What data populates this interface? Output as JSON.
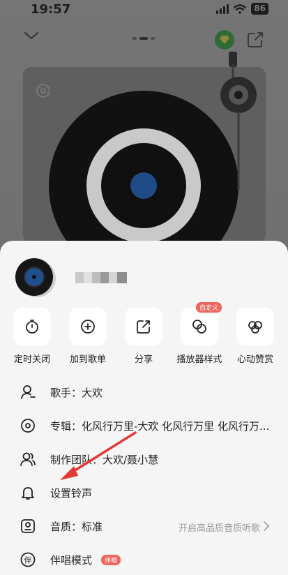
{
  "status_bar": {
    "time": "19:57",
    "battery": "86"
  },
  "sheet": {
    "actions": [
      {
        "label": "定时关闭",
        "icon": "timer-icon"
      },
      {
        "label": "加到歌单",
        "icon": "add-to-playlist-icon"
      },
      {
        "label": "分享",
        "icon": "share-icon"
      },
      {
        "label": "播放器样式",
        "icon": "player-style-icon",
        "badge": "自定义"
      },
      {
        "label": "心动赞赏",
        "icon": "appreciate-icon"
      }
    ],
    "menu": {
      "singer": "歌手：大欢",
      "album": "专辑：化风行万里-大欢 化风行万里 化风行万...",
      "team": "制作团队：大欢/聂小慧",
      "ringtone": "设置铃声",
      "quality": "音质：标准",
      "quality_hint": "开启高品质音质听歌",
      "karaoke": "伴唱模式",
      "karaoke_badge": "伴唱"
    }
  },
  "colors": {
    "accent_green": "#2f6a37",
    "badge_red": "#f0655e",
    "record_center_blue": "#1f4b86",
    "annotation_red": "#e53935"
  }
}
